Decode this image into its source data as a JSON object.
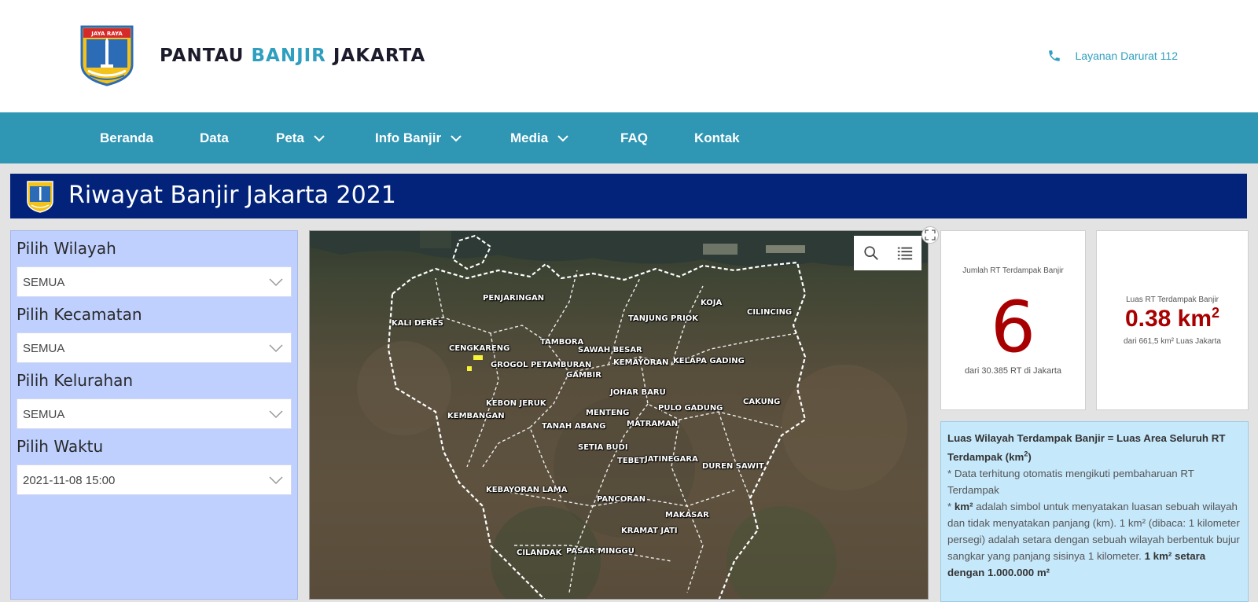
{
  "header": {
    "brand_part1": "PANTAU ",
    "brand_part2": "BANJIR",
    "brand_part3": " JAKARTA",
    "emergency_label": "Layanan Darurat 112",
    "logo_motto": "JAYA RAYA"
  },
  "nav": {
    "items": [
      {
        "label": "Beranda",
        "dropdown": false
      },
      {
        "label": "Data",
        "dropdown": false
      },
      {
        "label": "Peta",
        "dropdown": true
      },
      {
        "label": "Info Banjir",
        "dropdown": true
      },
      {
        "label": "Media",
        "dropdown": true
      },
      {
        "label": "FAQ",
        "dropdown": false
      },
      {
        "label": "Kontak",
        "dropdown": false
      }
    ]
  },
  "banner": {
    "title": "Riwayat Banjir Jakarta 2021"
  },
  "filters": {
    "wilayah": {
      "label": "Pilih Wilayah",
      "value": "SEMUA"
    },
    "kecamatan": {
      "label": "Pilih Kecamatan",
      "value": "SEMUA"
    },
    "kelurahan": {
      "label": "Pilih Kelurahan",
      "value": "SEMUA"
    },
    "waktu": {
      "label": "Pilih Waktu",
      "value": "2021-11-08 15:00"
    }
  },
  "map": {
    "districts": [
      "PENJARINGAN",
      "KALI DERES",
      "TANJUNG PRIOK",
      "KOJA",
      "CILINCING",
      "CENGKARENG",
      "TAMBORA",
      "SAWAH BESAR",
      "GROGOL PETAMBURAN",
      "KEMAYORAN",
      "KELAPA GADING",
      "GAMBIR",
      "JOHAR BARU",
      "CAKUNG",
      "KEBON JERUK",
      "PULO GADUNG",
      "KEMBANGAN",
      "MENTENG",
      "MATRAMAN",
      "TANAH ABANG",
      "SETIA BUDI",
      "TEBET",
      "JATINEGARA",
      "DUREN SAWIT",
      "KEBAYORAN LAMA",
      "PANCORAN",
      "MAKASAR",
      "KRAMAT JATI",
      "CILANDAK",
      "PASAR MINGGU"
    ]
  },
  "stats": {
    "rt": {
      "caption": "Jumlah RT Terdampak Banjir",
      "value": "6",
      "sub": "dari 30.385 RT di Jakarta"
    },
    "area": {
      "caption": "Luas RT Terdampak Banjir",
      "value": "0.38 km",
      "sup": "2",
      "sub": "dari 661,5 km² Luas Jakarta"
    }
  },
  "info": {
    "line1_bold": "Luas Wilayah Terdampak Banjir = Luas Area Seluruh RT Terdampak (km",
    "line1_sup": "2",
    "line1_end": ")",
    "line2": "* Data terhitung otomatis mengikuti pembaharuan RT Terdampak",
    "line3_prefix": "* ",
    "line3_bold": "km²",
    "line3_rest": " adalah simbol untuk menyatakan luasan sebuah wilayah dan tidak menyatakan panjang (km). 1 km² (dibaca: 1 kilometer persegi) adalah setara dengan sebuah wilayah berbentuk bujur sangkar yang panjang sisinya 1 kilometer. ",
    "line3_bold_end": "1 km² setara dengan 1.000.000 m²"
  },
  "colors": {
    "nav": "#2f96b4",
    "banner": "#03237a",
    "accent": "#2f9fbf",
    "stat": "#a80000",
    "filter_bg": "#bfd0ff",
    "info_bg": "#c6e8fb"
  }
}
